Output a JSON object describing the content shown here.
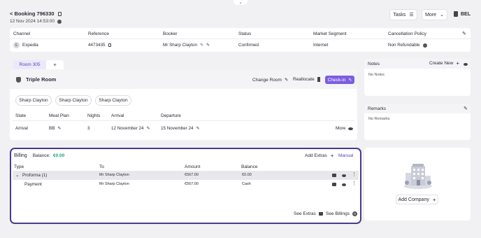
{
  "header": {
    "back_label": "< Booking 796330",
    "date": "12 Nov 2024 14:53:00",
    "tasks_label": "Tasks",
    "more_label": "More",
    "user_code": "BEL"
  },
  "booking_table": {
    "columns": [
      "Channel",
      "Reference",
      "Booker",
      "Status",
      "Market Segment",
      "Cancellation Policy"
    ],
    "row": {
      "channel": "Expedia",
      "reference": "4473435",
      "booker": "Mr Sharp Clayton",
      "status": "Confirmed",
      "market_segment": "Internet",
      "cancellation_policy": "Non Refundable"
    }
  },
  "room": {
    "tab_label": "Room 305",
    "add_tab_label": "+",
    "type": "Triple Room",
    "change_room_label": "Change Room",
    "reallocate_label": "Reallocate",
    "checkin_label": "Check-in",
    "guests": [
      "Sharp Clayton",
      "Sharp Clayton",
      "Sharp Clayton"
    ],
    "columns": [
      "State",
      "Meal Plan",
      "Nights",
      "Arrival",
      "Departure"
    ],
    "row": {
      "state": "Arrival",
      "meal_plan": "BB",
      "nights": "3",
      "arrival": "12 November 24",
      "departure": "15 November 24",
      "more_label": "More"
    }
  },
  "notes": {
    "title": "Notes",
    "create_new_label": "Create New",
    "empty_text": "No Notes"
  },
  "remarks": {
    "title": "Remarks",
    "empty_text": "No Remarks"
  },
  "billing": {
    "title": "Billing",
    "balance_label": "Balance:",
    "balance_value": "€0.00",
    "add_extras_label": "Add Extras",
    "manual_label": "Manual",
    "columns": [
      "Type",
      "To",
      "Amount",
      "Balance"
    ],
    "rows": [
      {
        "type": "Proforma (1)",
        "to": "Mr Sharp Clayton",
        "amount": "€567.00",
        "balance": "€0.00"
      },
      {
        "type": "Payment",
        "to": "Mr Sharp Clayton",
        "amount": "€567.00",
        "balance": "Cash"
      }
    ],
    "see_extras_label": "See Extras",
    "see_billings_label": "See Billings",
    "see_billings_count": "0"
  },
  "company": {
    "add_company_label": "Add Company",
    "add_symbol": "+"
  },
  "colors": {
    "accent": "#5b3fb5",
    "accent_light": "#8a6fe0",
    "balance_green": "#1aa37a",
    "tab_active_bg": "#ece8fb"
  }
}
